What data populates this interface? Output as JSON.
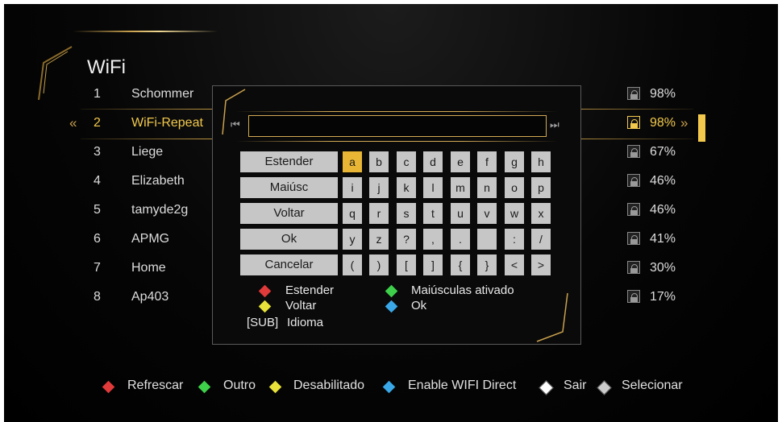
{
  "title": "WiFi",
  "networks": [
    {
      "num": "1",
      "ssid": "Schommer",
      "signal": "98%"
    },
    {
      "num": "2",
      "ssid": "WiFi-Repeat",
      "signal": "98%"
    },
    {
      "num": "3",
      "ssid": "Liege",
      "signal": "67%"
    },
    {
      "num": "4",
      "ssid": "Elizabeth",
      "signal": "46%"
    },
    {
      "num": "5",
      "ssid": "tamyde2g",
      "signal": "46%"
    },
    {
      "num": "6",
      "ssid": "APMG",
      "signal": "41%"
    },
    {
      "num": "7",
      "ssid": "Home",
      "signal": "30%"
    },
    {
      "num": "8",
      "ssid": "Ap403",
      "signal": "17%"
    }
  ],
  "selected_index": 1,
  "keyboard": {
    "input_value": "",
    "buttons": [
      "Estender",
      "Maiúsc",
      "Voltar",
      "Ok",
      "Cancelar"
    ],
    "rows": [
      [
        "a",
        "b",
        "c",
        "d",
        "e",
        "f",
        "g",
        "h"
      ],
      [
        "i",
        "j",
        "k",
        "l",
        "m",
        "n",
        "o",
        "p"
      ],
      [
        "q",
        "r",
        "s",
        "t",
        "u",
        "v",
        "w",
        "x"
      ],
      [
        "y",
        "z",
        "?",
        ",",
        ".",
        "",
        ":",
        "/"
      ],
      [
        "(",
        ")",
        "[",
        "]",
        "{",
        "}",
        "<",
        ">"
      ]
    ],
    "focused_key": "a"
  },
  "hints": {
    "red": "Estender",
    "green": "Maiúsculas ativado",
    "yellow": "Voltar",
    "blue": "Ok",
    "sub_key": "[SUB]",
    "sub_label": "Idioma"
  },
  "footer": {
    "red": "Refrescar",
    "green": "Outro",
    "yellow": "Desabilitado",
    "blue": "Enable WIFI Direct",
    "exit": "Sair",
    "ok": "Selecionar"
  },
  "colors": {
    "accent": "#f2c94c",
    "gold": "#c9a14e",
    "red": "#e03a3a",
    "green": "#3ed04a",
    "yellow": "#e8e23a",
    "blue": "#3aa8e8"
  }
}
